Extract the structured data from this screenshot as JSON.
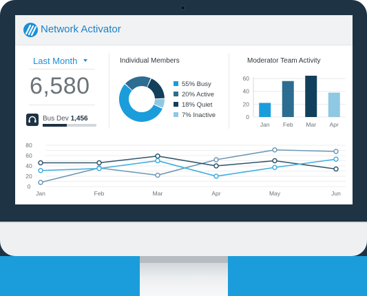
{
  "app": {
    "title": "Network Activator"
  },
  "period": {
    "label": "Last Month"
  },
  "total": {
    "value": "6,580"
  },
  "team": {
    "name": "Bus Dev",
    "value": "1,456",
    "progress": 0.45
  },
  "members": {
    "title": "Individual Members",
    "legend": [
      "55% Busy",
      "20% Active",
      "18% Quiet",
      "7% Inactive"
    ]
  },
  "moderator": {
    "title": "Moderator Team Activity"
  },
  "colors": {
    "accent": "#1b8fd6",
    "busy": "#1b9ddb",
    "active": "#2c6d91",
    "quiet": "#123f5c",
    "inactive": "#8fc8e2"
  },
  "chart_data": [
    {
      "type": "pie",
      "title": "Individual Members",
      "labels": [
        "Busy",
        "Active",
        "Quiet",
        "Inactive"
      ],
      "values": [
        55,
        20,
        18,
        7
      ],
      "colors": [
        "#1b9ddb",
        "#2c6d91",
        "#123f5c",
        "#8fc8e2"
      ]
    },
    {
      "type": "bar",
      "title": "Moderator Team Activity",
      "categories": [
        "Jan",
        "Feb",
        "Mar",
        "Apr"
      ],
      "values": [
        22,
        56,
        67,
        38
      ],
      "colors": [
        "#1b9ddb",
        "#2c6d91",
        "#123f5c",
        "#8fc8e2"
      ],
      "ylim": [
        0,
        60
      ],
      "yticks": [
        0,
        20,
        40,
        60
      ],
      "grid": true
    },
    {
      "type": "line",
      "categories": [
        "Jan",
        "Feb",
        "Mar",
        "Apr",
        "May",
        "Jun"
      ],
      "ylim": [
        0,
        80
      ],
      "yticks": [
        0,
        10,
        20,
        30,
        40,
        50,
        60,
        70,
        80
      ],
      "grid": true,
      "series": [
        {
          "values": [
            8,
            36,
            22,
            52,
            71,
            68
          ],
          "color": "#6e97b3"
        },
        {
          "values": [
            46,
            46,
            59,
            40,
            50,
            34
          ],
          "color": "#2f5368"
        },
        {
          "values": [
            31,
            35,
            50,
            20,
            37,
            53
          ],
          "color": "#3daee0"
        }
      ]
    }
  ]
}
